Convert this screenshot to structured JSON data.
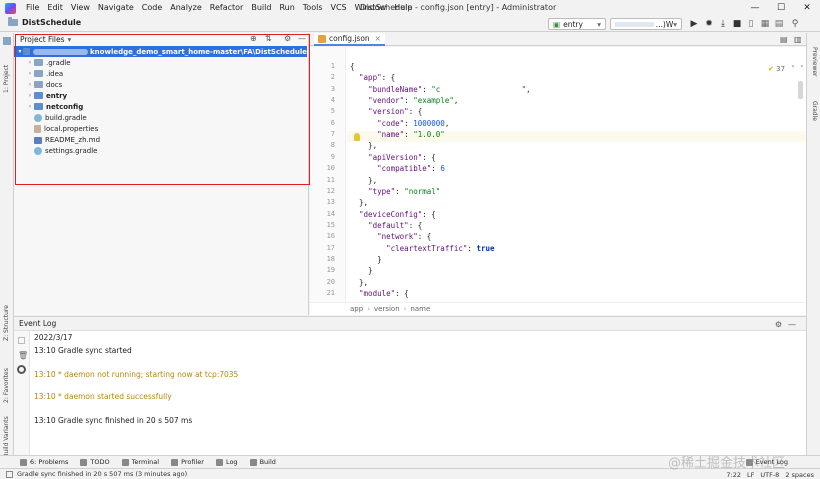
{
  "menu": {
    "items": [
      "File",
      "Edit",
      "View",
      "Navigate",
      "Code",
      "Analyze",
      "Refactor",
      "Build",
      "Run",
      "Tools",
      "VCS",
      "Window",
      "Help"
    ]
  },
  "window_title": "DistSchedule - config.json [entry] - Administrator",
  "window_controls": {
    "minimize": "—",
    "maximize": "☐",
    "close": "✕"
  },
  "toolbar": {
    "project_name": "DistSchedule",
    "run_config": "entry",
    "device_suffix": "...)W"
  },
  "left_tabs": {
    "project": "1: Project",
    "structure": "Z: Structure",
    "favorites": "2: Favorites",
    "variants": "OhosBuild Variants"
  },
  "right_tabs": {
    "previewer": "Previewer",
    "gradle": "Gradle"
  },
  "project_panel": {
    "title": "Project Files",
    "root_label": "knowledge_demo_smart_home-master\\FA\\DistSchedule",
    "items": [
      {
        "name": ".gradle",
        "type": "folder",
        "expandable": true,
        "bold": false
      },
      {
        "name": ".idea",
        "type": "folder",
        "expandable": true,
        "bold": false
      },
      {
        "name": "docs",
        "type": "folder",
        "expandable": true,
        "bold": false
      },
      {
        "name": "entry",
        "type": "module",
        "expandable": true,
        "bold": true
      },
      {
        "name": "netconfig",
        "type": "module",
        "expandable": true,
        "bold": true
      },
      {
        "name": "build.gradle",
        "type": "gradle",
        "expandable": false,
        "bold": false
      },
      {
        "name": "local.properties",
        "type": "properties",
        "expandable": false,
        "bold": false
      },
      {
        "name": "README_zh.md",
        "type": "markdown",
        "expandable": false,
        "bold": false
      },
      {
        "name": "settings.gradle",
        "type": "gradle",
        "expandable": false,
        "bold": false
      }
    ]
  },
  "editor": {
    "tab": "config.json",
    "inspection_count": "37",
    "line_numbers": [
      "1",
      "2",
      "3",
      "4",
      "5",
      "6",
      "7",
      "8",
      "9",
      "10",
      "11",
      "12",
      "13",
      "14",
      "15",
      "16",
      "17",
      "18",
      "19",
      "20",
      "21"
    ],
    "lines": [
      "{",
      "  \"app\": {",
      "    \"bundleName\": \"c                  \",",
      "    \"vendor\": \"example\",",
      "    \"version\": {",
      "      \"code\": 1000000,",
      "      \"name\": \"1.0.0\"",
      "    },",
      "    \"apiVersion\": {",
      "      \"compatible\": 6",
      "    },",
      "    \"type\": \"normal\"",
      "  },",
      "  \"deviceConfig\": {",
      "    \"default\": {",
      "      \"network\": {",
      "        \"cleartextTraffic\": true",
      "      }",
      "    }",
      "  },",
      "  \"module\": {"
    ],
    "breadcrumb": [
      "app",
      "version",
      "name"
    ]
  },
  "event_log": {
    "title": "Event Log",
    "entries": [
      {
        "text": "2022/3/17",
        "level": "info"
      },
      {
        "text": "13:10  Gradle sync started",
        "level": "info"
      },
      {
        "text": "13:10  * daemon not running; starting now at tcp:7035",
        "level": "warn"
      },
      {
        "text": "13:10  * daemon started successfully",
        "level": "warn"
      },
      {
        "text": "13:10  Gradle sync finished in 20 s 507 ms",
        "level": "info"
      }
    ]
  },
  "bottom_tools": [
    "6: Problems",
    "TODO",
    "Terminal",
    "Profiler",
    "Log",
    "Build"
  ],
  "status": {
    "message": "Gradle sync finished in 20 s 507 ms (3 minutes ago)",
    "position": "7:22",
    "line_ending": "LF",
    "encoding": "UTF-8",
    "indent": "2 spaces",
    "event_log_label": "Event Log"
  },
  "watermark": "@稀土掘金技术社区",
  "colors": {
    "selection": "#2f6fe0",
    "highlight_box": "#e02020",
    "string": "#067d17",
    "number": "#1750eb",
    "key": "#660e7a"
  }
}
